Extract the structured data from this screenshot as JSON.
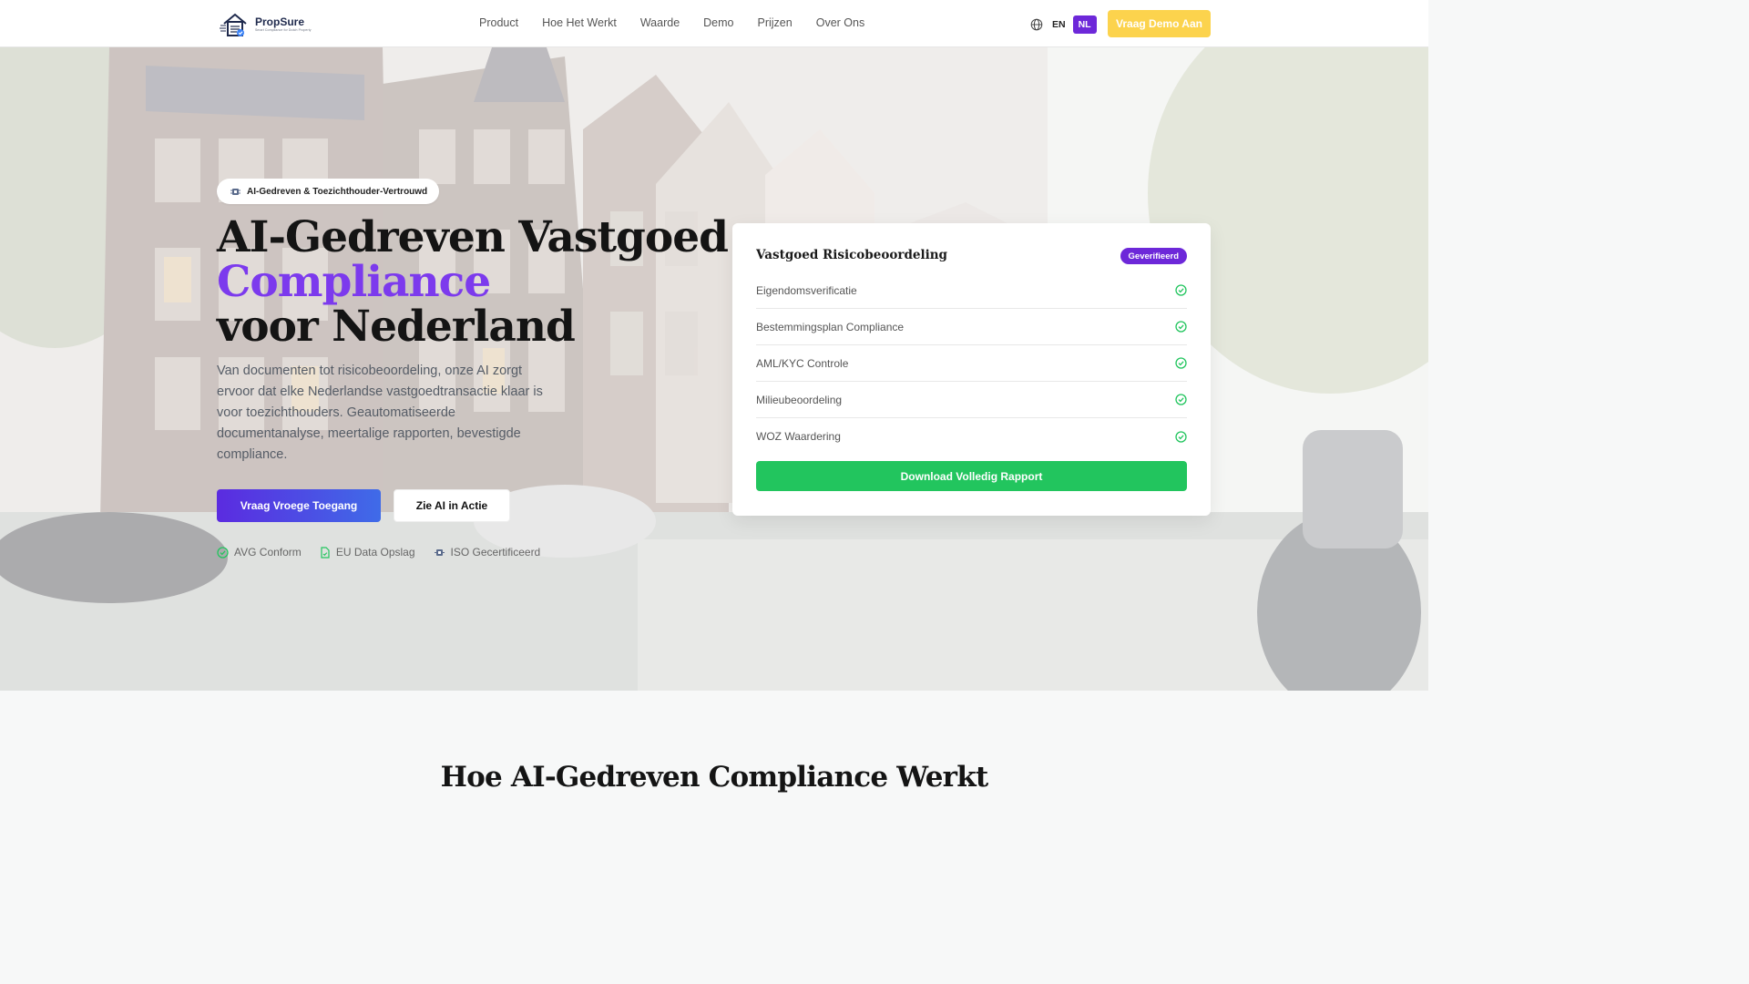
{
  "brand": {
    "name": "PropSure",
    "tagline": "Smart Compliance for Dutch Property"
  },
  "nav": {
    "items": [
      "Product",
      "Hoe Het Werkt",
      "Waarde",
      "Demo",
      "Prijzen",
      "Over Ons"
    ],
    "lang_en": "EN",
    "lang_nl": "NL",
    "cta": "Vraag Demo Aan"
  },
  "hero": {
    "badge": "AI-Gedreven & Toezichthouder-Vertrouwd",
    "title_line1": "AI-Gedreven Vastgoed",
    "title_accent": "Compliance",
    "title_line3": "voor Nederland",
    "lede": "Van documenten tot risicobeoordeling, onze AI zorgt ervoor dat elke Nederlandse vastgoedtransactie klaar is voor toezichthouders. Geautomatiseerde documentanalyse, meertalige rapporten, bevestigde compliance.",
    "primary_cta": "Vraag Vroege Toegang",
    "secondary_cta": "Zie AI in Actie",
    "trust": [
      "AVG Conform",
      "EU Data Opslag",
      "ISO Gecertificeerd"
    ]
  },
  "card": {
    "title": "Vastgoed Risicobeoordeling",
    "status": "Geverifieerd",
    "checks": [
      "Eigendomsverificatie",
      "Bestemmingsplan Compliance",
      "AML/KYC Controle",
      "Milieubeoordeling",
      "WOZ Waardering"
    ],
    "download": "Download Volledig Rapport"
  },
  "section2": {
    "title": "Hoe AI-Gedreven Compliance Werkt"
  },
  "colors": {
    "accent": "#7c3aed",
    "cta_yellow": "#fcd34d",
    "success": "#22c55e",
    "badge_purple": "#6d28d9"
  }
}
